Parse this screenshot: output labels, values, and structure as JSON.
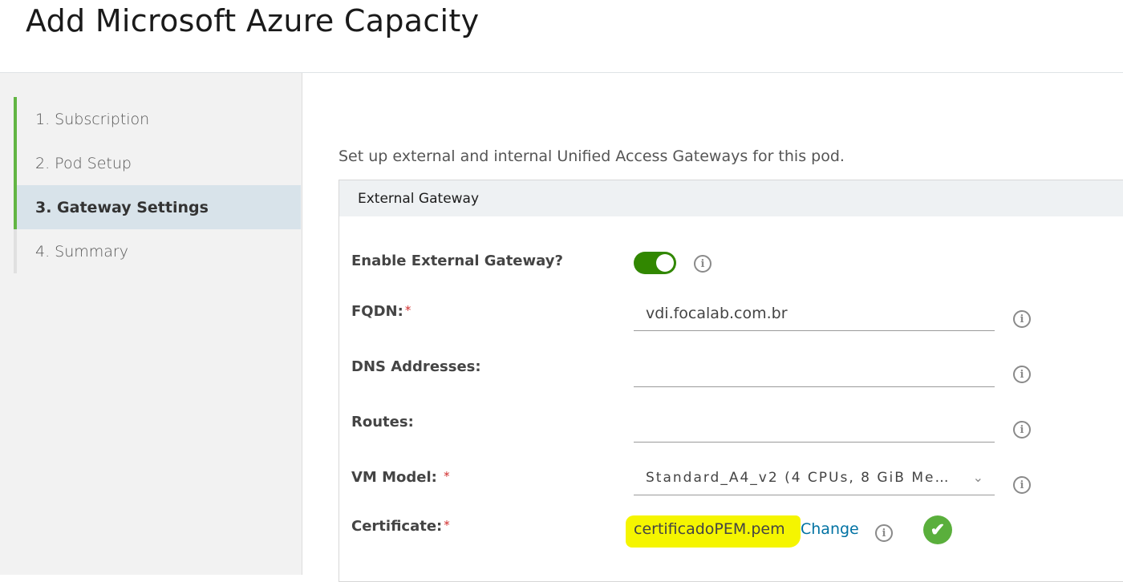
{
  "page_title": "Add Microsoft Azure Capacity",
  "steps": [
    {
      "label": "1. Subscription",
      "state": "done"
    },
    {
      "label": "2. Pod Setup",
      "state": "done"
    },
    {
      "label": "3. Gateway Settings",
      "state": "active"
    },
    {
      "label": "4. Summary",
      "state": "pending"
    }
  ],
  "intro": "Set up external and internal Unified Access Gateways for this pod.",
  "panel": {
    "header": "External Gateway",
    "enable_label": "Enable External Gateway?",
    "enable_value": true,
    "fqdn_label": "FQDN:",
    "fqdn_value": "vdi.focalab.com.br",
    "dns_label": "DNS Addresses:",
    "dns_value": "",
    "routes_label": "Routes:",
    "routes_value": "",
    "vm_label": "VM Model:",
    "vm_value": "Standard_A4_v2 (4 CPUs, 8 GiB Me…",
    "cert_label": "Certificate:",
    "cert_value": "certificadoPEM.pem",
    "change_label": "Change",
    "required_mark": "*",
    "info_glyph": "i",
    "check_glyph": "✔"
  },
  "colors": {
    "accent_green": "#62b543",
    "toggle_green": "#318700",
    "link_blue": "#0072a3",
    "highlight": "#f5f500"
  }
}
